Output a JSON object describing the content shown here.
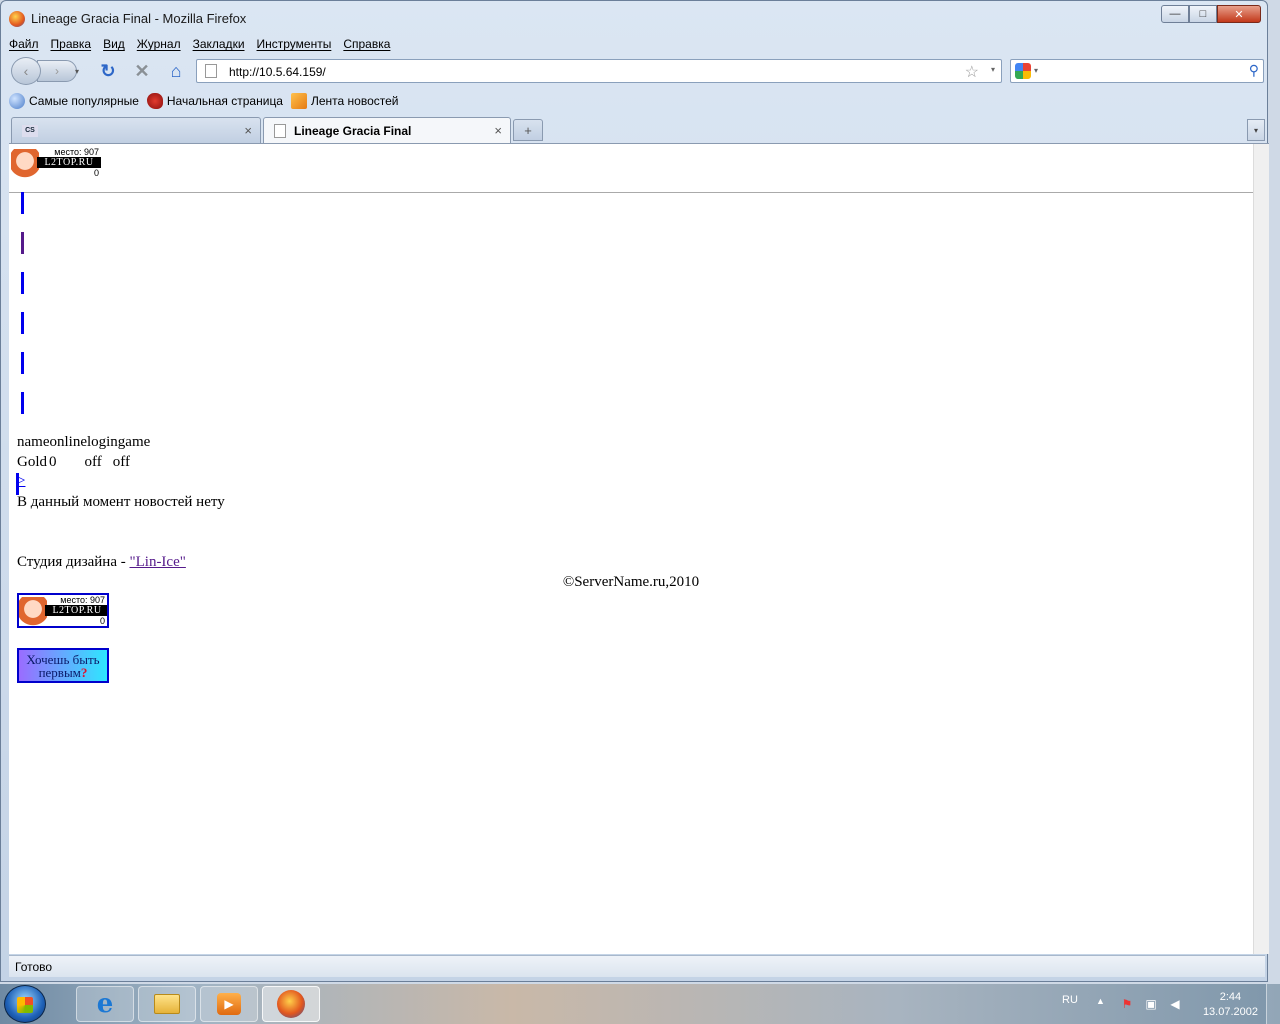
{
  "window": {
    "title": "Lineage Gracia Final - Mozilla Firefox",
    "min_glyph": "—",
    "max_glyph": "□",
    "close_glyph": "✕"
  },
  "menu": [
    "Файл",
    "Правка",
    "Вид",
    "Журнал",
    "Закладки",
    "Инструменты",
    "Справка"
  ],
  "nav": {
    "url": "http://10.5.64.159/",
    "back_glyph": "‹",
    "fwd_glyph": "›",
    "drop_glyph": "▾",
    "reload_glyph": "↻",
    "stop_glyph": "✕",
    "home_glyph": "⌂",
    "star_glyph": "☆",
    "search_glyph": "⚲",
    "search_value": ""
  },
  "bookmarks": [
    {
      "label": "Самые популярные",
      "icon": "popular-icon"
    },
    {
      "label": "Начальная страница",
      "icon": "start-page-icon"
    },
    {
      "label": "Лента новостей",
      "icon": "rss-icon"
    }
  ],
  "tabs": [
    {
      "label": "",
      "favicon_text": "CS",
      "active": false
    },
    {
      "label": "Lineage Gracia Final",
      "active": true
    }
  ],
  "tab_close_glyph": "×",
  "newtab_glyph": "+",
  "l2top": {
    "place": "место: 907",
    "site": "L2TOP.RU",
    "count": "0"
  },
  "page": {
    "status_header": "nameonlinelogingame",
    "server": {
      "name": "Gold",
      "online": "0",
      "login": "off",
      "game": "off"
    },
    "arrow_link": ">",
    "news": "В данный момент новостей нету",
    "credit_prefix": "Студия дизайна - ",
    "credit_link": "\"Lin-Ice\"",
    "copyright": "©ServerName.ru,2010",
    "cta_line1": "Хочешь быть",
    "cta_line2": "первым",
    "cta_q": "?"
  },
  "statusbar": {
    "text": "Готово"
  },
  "taskbar": {
    "lang": "RU",
    "tray_up": "▲",
    "time": "2:44",
    "date": "13.07.2002",
    "ie_glyph": "e",
    "media_glyph": "▶"
  }
}
